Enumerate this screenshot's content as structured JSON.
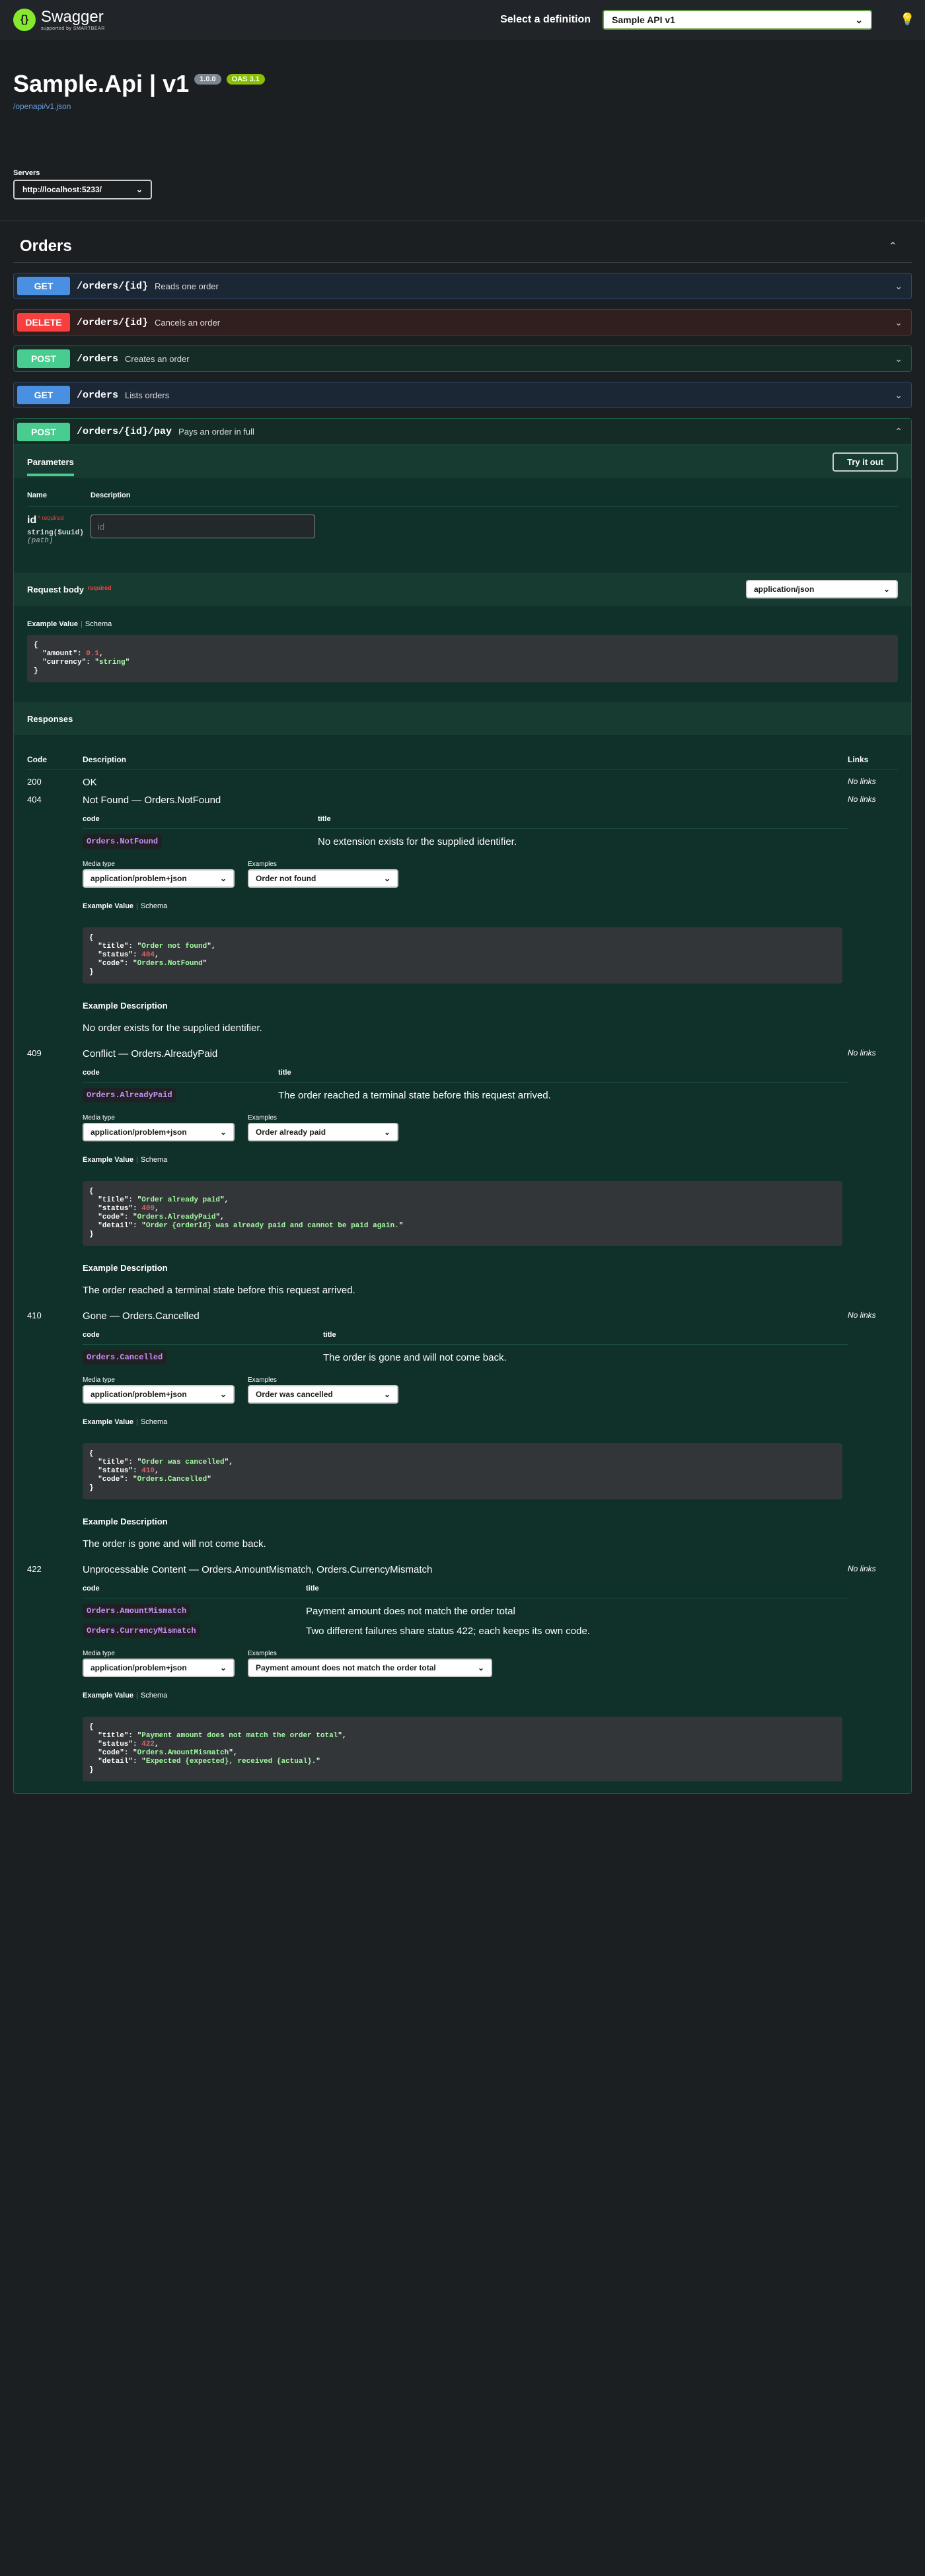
{
  "topbar": {
    "logo_title": "Swagger",
    "logo_sub": "supported by SMARTBEAR",
    "select_label": "Select a definition",
    "definition": "Sample API v1"
  },
  "info": {
    "title": "Sample.Api | v1",
    "version": "1.0.0",
    "oas": "OAS 3.1",
    "spec_link": "/openapi/v1.json"
  },
  "servers": {
    "label": "Servers",
    "selected": "http://localhost:5233/"
  },
  "tag": {
    "name": "Orders"
  },
  "operations": [
    {
      "method": "GET",
      "path": "/orders/{id}",
      "summary": "Reads one order"
    },
    {
      "method": "DELETE",
      "path": "/orders/{id}",
      "summary": "Cancels an order"
    },
    {
      "method": "POST",
      "path": "/orders",
      "summary": "Creates an order"
    },
    {
      "method": "GET",
      "path": "/orders",
      "summary": "Lists orders"
    },
    {
      "method": "POST",
      "path": "/orders/{id}/pay",
      "summary": "Pays an order in full"
    }
  ],
  "expanded": {
    "tab": "Parameters",
    "try_it_out": "Try it out",
    "param_headers": {
      "name": "Name",
      "description": "Description"
    },
    "param": {
      "name": "id",
      "required": "* required",
      "type": "string($uuid)",
      "in": "(path)",
      "placeholder": "id"
    },
    "request_body": {
      "label": "Request body",
      "required": "required",
      "content_type": "application/json"
    },
    "example_value": "Example Value",
    "schema": "Schema",
    "body_example": {
      "amount": "0.1",
      "currency": "string"
    },
    "responses_label": "Responses",
    "resp_headers": {
      "code": "Code",
      "description": "Description",
      "links": "Links"
    },
    "sub_headers": {
      "code": "code",
      "title": "title"
    },
    "media_type_label": "Media type",
    "examples_label": "Examples",
    "media_type": "application/problem+json",
    "example_desc_label": "Example Description",
    "responses": [
      {
        "code": "200",
        "desc": "OK",
        "links": "No links"
      },
      {
        "code": "404",
        "desc": "Not Found — Orders.NotFound",
        "links": "No links",
        "codes": [
          {
            "code": "Orders.NotFound",
            "title": "No extension exists for the supplied identifier."
          }
        ],
        "example": "Order not found",
        "json": {
          "title": "Order not found",
          "status": "404",
          "code": "Orders.NotFound"
        },
        "explanation": "No order exists for the supplied identifier."
      },
      {
        "code": "409",
        "desc": "Conflict — Orders.AlreadyPaid",
        "links": "No links",
        "codes": [
          {
            "code": "Orders.AlreadyPaid",
            "title": "The order reached a terminal state before this request arrived."
          }
        ],
        "example": "Order already paid",
        "json": {
          "title": "Order already paid",
          "status": "409",
          "code": "Orders.AlreadyPaid",
          "detail": "Order {orderId} was already paid and cannot be paid again."
        },
        "explanation": "The order reached a terminal state before this request arrived."
      },
      {
        "code": "410",
        "desc": "Gone — Orders.Cancelled",
        "links": "No links",
        "codes": [
          {
            "code": "Orders.Cancelled",
            "title": "The order is gone and will not come back."
          }
        ],
        "example": "Order was cancelled",
        "json": {
          "title": "Order was cancelled",
          "status": "410",
          "code": "Orders.Cancelled"
        },
        "explanation": "The order is gone and will not come back."
      },
      {
        "code": "422",
        "desc": "Unprocessable Content — Orders.AmountMismatch, Orders.CurrencyMismatch",
        "links": "No links",
        "codes": [
          {
            "code": "Orders.AmountMismatch",
            "title": "Payment amount does not match the order total"
          },
          {
            "code": "Orders.CurrencyMismatch",
            "title": "Two different failures share status 422; each keeps its own code."
          }
        ],
        "example": "Payment amount does not match the order total",
        "json": {
          "title": "Payment amount does not match the order total",
          "status": "422",
          "code": "Orders.AmountMismatch",
          "detail": "Expected {expected}, received {actual}."
        }
      }
    ]
  }
}
